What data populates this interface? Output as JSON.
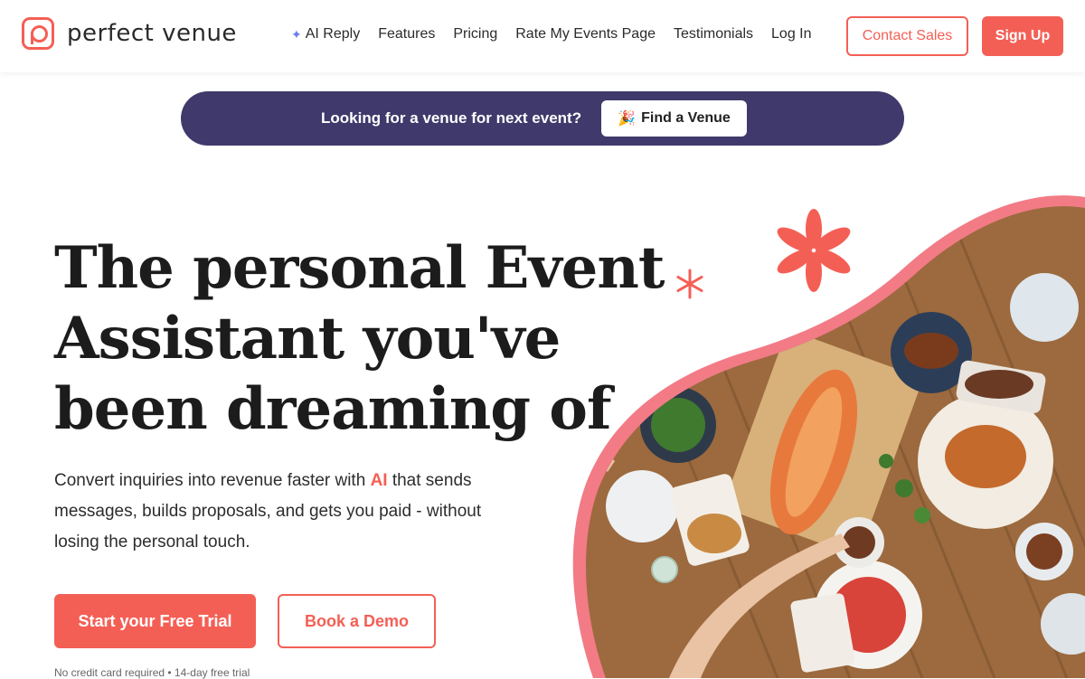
{
  "brand": {
    "name": "perfect venue",
    "color": "#f45f55"
  },
  "nav": {
    "items": [
      {
        "label": "AI Reply",
        "icon": "sparkle-icon"
      },
      {
        "label": "Features"
      },
      {
        "label": "Pricing"
      },
      {
        "label": "Rate My Events Page"
      },
      {
        "label": "Testimonials"
      },
      {
        "label": "Log In"
      }
    ],
    "contact_sales": "Contact Sales",
    "sign_up": "Sign Up"
  },
  "banner": {
    "text": "Looking for a venue for next event?",
    "button_label": "Find a Venue",
    "button_icon": "party-popper-icon",
    "background": "#3f3a6b"
  },
  "hero": {
    "title": "The personal Event Assistant you've been dreaming of",
    "subtitle_before": "Convert inquiries into revenue faster with ",
    "subtitle_highlight": "AI",
    "subtitle_after": " that sends messages, builds proposals, and gets you paid - without losing the personal touch.",
    "cta_primary": "Start your Free Trial",
    "cta_secondary": "Book a Demo",
    "fineprint": "No credit card required • 14-day free trial"
  },
  "decor": {
    "star_color": "#f45f55",
    "blob_border": "#f27b86"
  }
}
